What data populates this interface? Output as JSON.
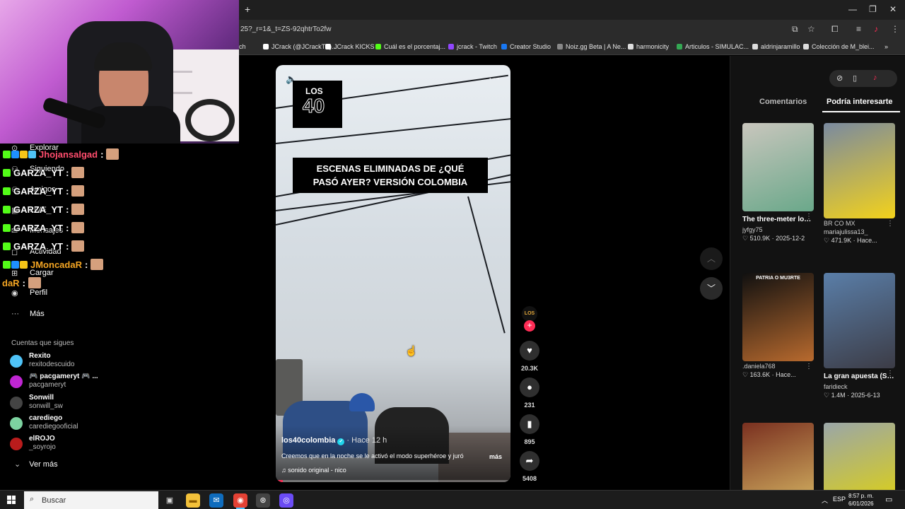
{
  "browser": {
    "new_tab": "+",
    "url": "25?_r=1&_t=ZS-92qhtrTo2fw",
    "window_controls": {
      "min": "—",
      "max": "❐",
      "close": "✕"
    },
    "bookmarks": [
      {
        "label": "ch",
        "color": "#2b2b2b"
      },
      {
        "label": "JCrack (@JCrackTV)...",
        "color": "#ffffff"
      },
      {
        "label": "JCrack KICKS",
        "color": "#ffffff"
      },
      {
        "label": "Cuál es el porcentaj...",
        "color": "#53fc18"
      },
      {
        "label": "jcrack - Twitch",
        "color": "#9146ff"
      },
      {
        "label": "Creator Studio",
        "color": "#1877f2"
      },
      {
        "label": "Noiz.gg Beta | A Ne...",
        "color": "#888888"
      },
      {
        "label": "harmonicity",
        "color": "#dddddd"
      },
      {
        "label": "Articulos - SIMULAC...",
        "color": "#34a853"
      },
      {
        "label": "aldrinjaramillo",
        "color": "#dddddd"
      },
      {
        "label": "Colección de M_blei...",
        "color": "#dddddd"
      }
    ],
    "bookmarks_more": "»"
  },
  "chat": [
    {
      "user": "Jhojansalgad",
      "color": "#ff4d6d",
      "sep": ":",
      "badges": [
        "#53fc18",
        "#1e90ff",
        "#f5c518",
        "#4fc3f7"
      ]
    },
    {
      "user": "GARZA_YT",
      "color": "#ffffff",
      "sep": ":",
      "badges": [
        "#53fc18"
      ]
    },
    {
      "user": "GARZA_YT",
      "color": "#ffffff",
      "sep": ":",
      "badges": [
        "#53fc18"
      ]
    },
    {
      "user": "GARZA_YT",
      "color": "#ffffff",
      "sep": ":",
      "badges": [
        "#53fc18"
      ]
    },
    {
      "user": "GARZA_YT",
      "color": "#ffffff",
      "sep": ":",
      "badges": [
        "#53fc18"
      ]
    },
    {
      "user": "GARZA_YT",
      "color": "#ffffff",
      "sep": ":",
      "badges": [
        "#53fc18"
      ]
    },
    {
      "user": "JMoncadaR",
      "color": "#f5a623",
      "sep": ":",
      "badges": [
        "#53fc18",
        "#1e90ff",
        "#f5c518"
      ]
    },
    {
      "user": "daR",
      "color": "#f5a623",
      "sep": ":",
      "badges": []
    }
  ],
  "sidebar": {
    "nav": [
      {
        "label": "Explorar",
        "icon": "⊙"
      },
      {
        "label": "Siguiendo",
        "icon": "⚇"
      },
      {
        "label": "Amigos",
        "icon": "⚇"
      },
      {
        "label": "LIVE",
        "icon": "▣"
      },
      {
        "label": "Mensajes",
        "icon": "✉"
      },
      {
        "label": "Actividad",
        "icon": "◻"
      },
      {
        "label": "Cargar",
        "icon": "⊞"
      },
      {
        "label": "Perfil",
        "icon": "◉"
      },
      {
        "label": "Más",
        "icon": "···"
      }
    ],
    "following_title": "Cuentas que sigues",
    "accounts": [
      {
        "name": "Rexito",
        "handle": "rexitodescuido",
        "color": "#4fc3f7"
      },
      {
        "name": "🎮 pacgameryt 🎮 ...",
        "handle": "pacgameryt",
        "color": "#c026d3"
      },
      {
        "name": "Sonwill",
        "handle": "sonwill_sw",
        "color": "#444444"
      },
      {
        "name": "carediego",
        "handle": "carediegooficial",
        "color": "#7dd3a0"
      },
      {
        "name": "elROJO",
        "handle": "_soyrojo",
        "color": "#b91c1c"
      }
    ],
    "see_more": "Ver más",
    "see_more_icon": "⌄"
  },
  "video": {
    "logo_top": "LOS",
    "logo_num": "40",
    "caption_line1": "ESCENAS ELIMINADAS DE ¿QUÉ",
    "caption_line2": "PASÓ AYER? VERSIÓN COLOMBIA",
    "volume_icon": "🔈",
    "more_icon": "···",
    "author": "los40colombia",
    "verified_icon": "✓",
    "time_ago": "· Hace 12 h",
    "description": "Creemos que en la noche se le activó el modo superhéroe y juró",
    "desc_more": "más",
    "music": "♫  sonido original - nico",
    "progress": 0.03
  },
  "actions": {
    "avatar_label": "LOS 40",
    "follow": "+",
    "likes": "20.3K",
    "comments": "231",
    "saves": "895",
    "shares": "5408",
    "like_icon": "♥",
    "comment_icon": "●",
    "save_icon": "▮",
    "share_icon": "➦"
  },
  "nav_arrows": {
    "up": "︿",
    "down": "﹀"
  },
  "right_panel": {
    "tabs": [
      "Comentarios",
      "Podría interesarte"
    ],
    "active_tab": 1,
    "cards": [
      {
        "title": "The three-meter long shark was...",
        "user": "jyfgy75",
        "likes": "510.9K",
        "date": "2025-12-2",
        "thumb_tag": "",
        "colors": [
          "#c9c6bd",
          "#6aa88a"
        ]
      },
      {
        "title": "",
        "sub": "BR CO MX",
        "user": "mariajulissa13_",
        "likes": "471.9K",
        "date": "Hace...",
        "thumb_tag": "",
        "colors": [
          "#7a8aa0",
          "#f3d21b"
        ]
      },
      {
        "title": "",
        "user": ".daniela768",
        "likes": "163.6K",
        "date": "Hace...",
        "thumb_tag": "PATRIA O MU3RTE",
        "colors": [
          "#101010",
          "#b86a2e"
        ]
      },
      {
        "title": "La gran apuesta (Spoilers)....",
        "user": "faridieck",
        "likes": "1.4M",
        "date": "2025-6-13",
        "thumb_tag": "",
        "colors": [
          "#5a7ea8",
          "#3c3c46"
        ]
      },
      {
        "title": "",
        "user": "",
        "likes": "",
        "date": "",
        "thumb_tag": "",
        "colors": [
          "#7a3020",
          "#c9a35a"
        ]
      },
      {
        "title": "",
        "user": "",
        "likes": "",
        "date": "",
        "thumb_tag": "",
        "colors": [
          "#9aa6a8",
          "#d6cc24"
        ]
      }
    ]
  },
  "taskbar": {
    "search": "Buscar",
    "search_icon": "⌕",
    "lang": "ESP",
    "time": "8:57 p. m.",
    "date": "6/01/2026",
    "tray_up": "︿",
    "notif_icon": "▭",
    "apps": [
      {
        "icon": "▣",
        "bg": "transparent",
        "color": "#ddd"
      },
      {
        "icon": "▬",
        "bg": "#f3c13a",
        "color": "#8a5a00"
      },
      {
        "icon": "✉",
        "bg": "#0f6cbd",
        "color": "#fff"
      },
      {
        "icon": "◉",
        "bg": "#e44134",
        "color": "#fff"
      },
      {
        "icon": "⊛",
        "bg": "#444",
        "color": "#fff"
      },
      {
        "icon": "◎",
        "bg": "#6b4cf5",
        "color": "#fff"
      }
    ]
  }
}
